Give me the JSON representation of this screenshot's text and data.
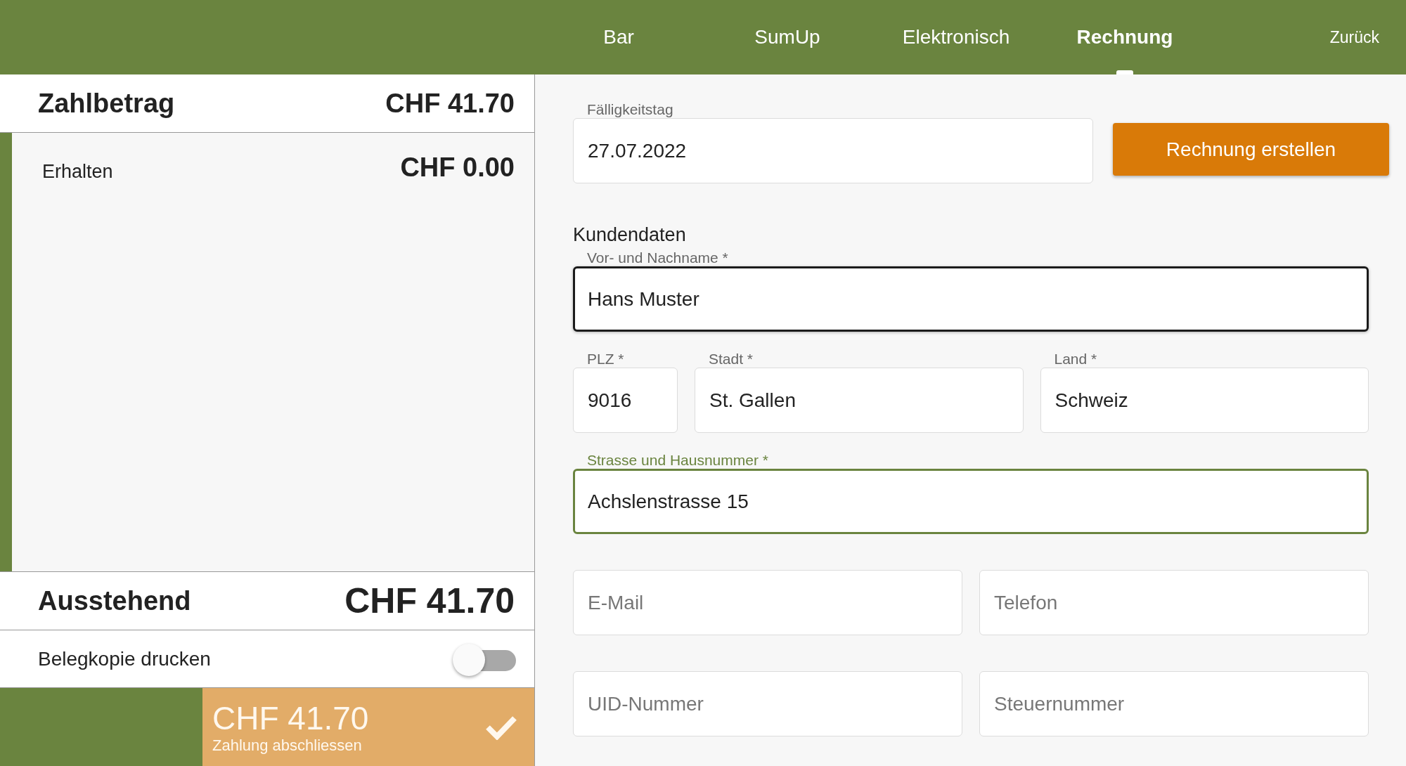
{
  "tabs": [
    {
      "label": "Bar",
      "selected": false
    },
    {
      "label": "SumUp",
      "selected": false
    },
    {
      "label": "Elektronisch",
      "selected": false
    },
    {
      "label": "Rechnung",
      "selected": true
    }
  ],
  "back_link": "Zurück",
  "summary": {
    "due_label": "Zahlbetrag",
    "due_amount": "CHF 41.70",
    "received_label": "Erhalten",
    "received_amount": "CHF 0.00",
    "outstanding_label": "Ausstehend",
    "outstanding_amount": "CHF 41.70"
  },
  "receipt_copy": {
    "label": "Belegkopie drucken",
    "on": false
  },
  "pay_button": {
    "amount": "CHF 41.70",
    "label": "Zahlung abschliessen",
    "disabled": true
  },
  "due_date": {
    "label": "Fälligkeitstag",
    "value": "27.07.2022",
    "focused": false,
    "hovered": false
  },
  "create_button": "Rechnung erstellen",
  "customer_heading": "Kundendaten",
  "field_rows": [
    [
      {
        "kind": "wide",
        "label": "Vor- und Nachname *",
        "value": "Hans Muster",
        "focused": false,
        "hovered": true
      }
    ],
    [
      {
        "kind": "short",
        "label": "PLZ *",
        "value": "9016",
        "focused": false,
        "hovered": false
      },
      {
        "kind": "wide",
        "label": "Stadt *",
        "value": "St. Gallen",
        "focused": false,
        "hovered": false
      },
      {
        "kind": "wide",
        "label": "Land *",
        "value": "Schweiz",
        "focused": false,
        "hovered": false
      }
    ],
    [
      {
        "kind": "wide",
        "label": "Strasse und Hausnummer *",
        "value": "Achslenstrasse 15",
        "focused": true,
        "hovered": false
      }
    ],
    [
      {
        "kind": "wide",
        "placeholder": "E-Mail",
        "focused": false,
        "hovered": false
      },
      {
        "kind": "wide",
        "placeholder": "Telefon",
        "focused": false,
        "hovered": false
      }
    ],
    [
      {
        "kind": "wide",
        "placeholder": "UID-Nummer",
        "focused": false,
        "hovered": false
      },
      {
        "kind": "wide",
        "placeholder": "Steuernummer",
        "focused": false,
        "hovered": false
      }
    ]
  ]
}
